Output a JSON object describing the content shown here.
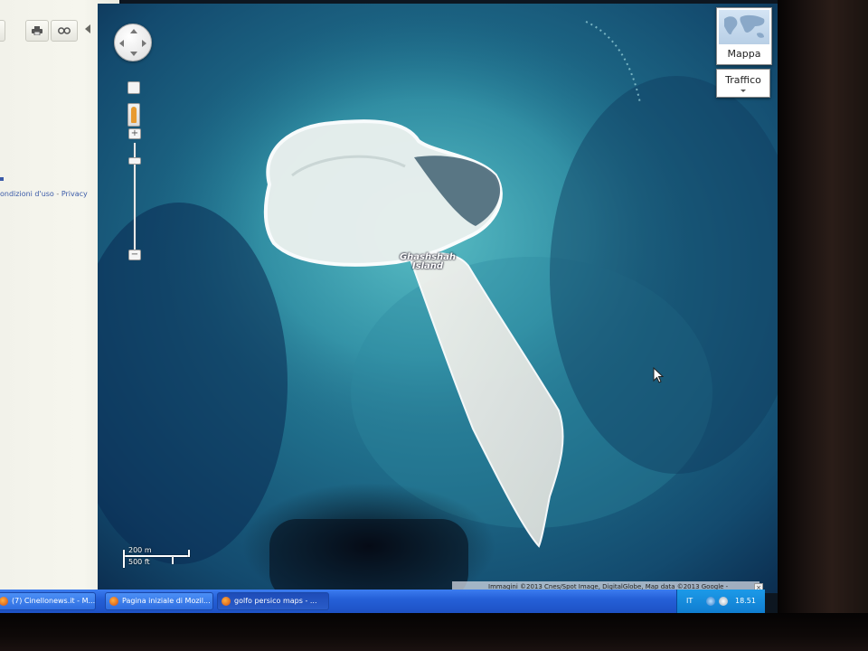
{
  "sidebar": {
    "legal_text": "ondizioni d'uso",
    "legal_sep": " - ",
    "privacy_text": "Privacy",
    "print_icon": "print-icon",
    "link_icon": "link-icon"
  },
  "map": {
    "place_label_line1": "Ghashshah",
    "place_label_line2": "Island",
    "map_type_label": "Mappa",
    "traffic_label": "Traffico",
    "scale_metric": "200 m",
    "scale_imperial": "500 ft",
    "attribution": "Immagini ©2013 Cnes/Spot Image, DigitalGlobe, Map data ©2013 Google -",
    "attribution_close": "×"
  },
  "taskbar": {
    "tasks": [
      {
        "label": "(7) Cinellonews.it - M..."
      },
      {
        "label": "Pagina iniziale di Mozil..."
      },
      {
        "label": "golfo persico maps - ..."
      }
    ],
    "language": "IT",
    "clock": "18.51"
  },
  "colors": {
    "sea_deep": "#0d2a4a",
    "sea_shallow": "#3aa3b5",
    "sand": "#e8ece8",
    "taskbar": "#2560d8"
  }
}
